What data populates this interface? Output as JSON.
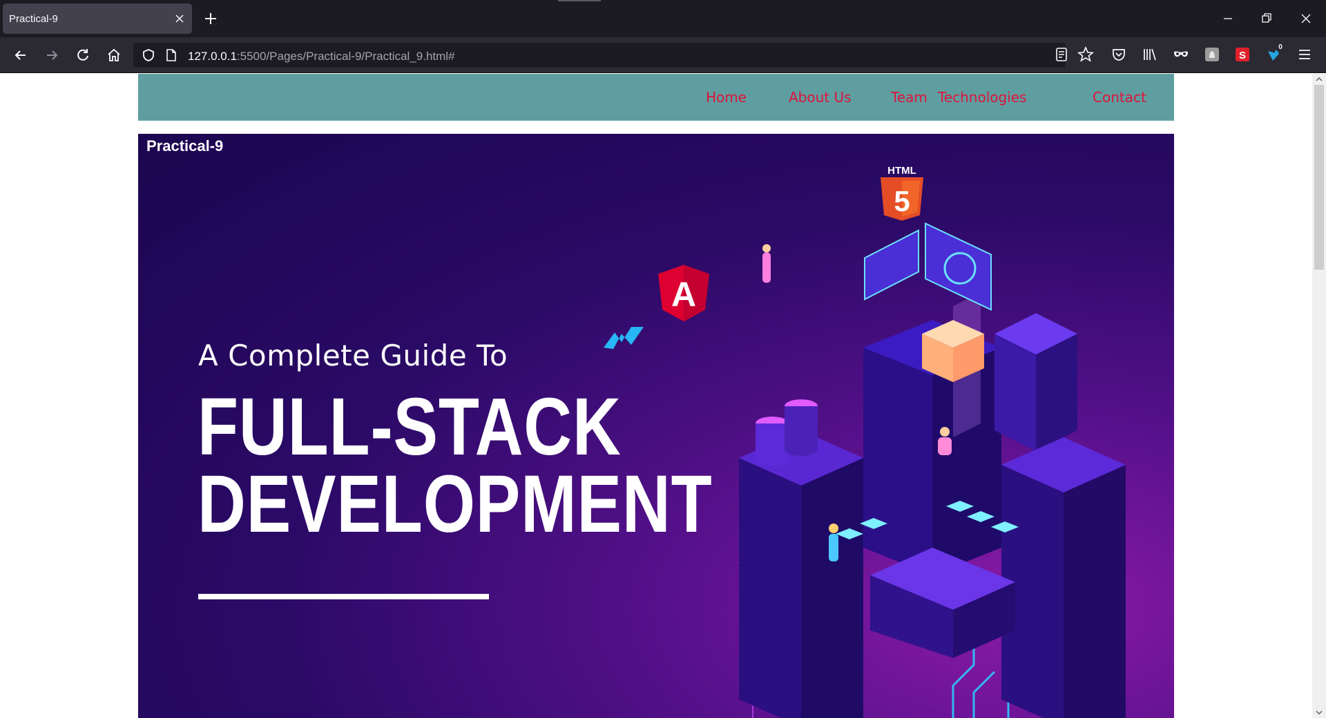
{
  "browser": {
    "tab_title": "Practical-9",
    "url_host": "127.0.0.1",
    "url_path": ":5500/Pages/Practical-9/Practical_9.html#",
    "extension_badge": "0",
    "icons": [
      "back-icon",
      "forward-icon",
      "reload-icon",
      "home-icon",
      "shield-icon",
      "page-icon",
      "reader-view-icon",
      "bookmark-star-icon",
      "pocket-icon",
      "library-icon",
      "mask-icon",
      "extension-icon",
      "s-extension-icon",
      "notification-extension-icon",
      "menu-icon"
    ]
  },
  "site_nav": {
    "links": [
      "Home",
      "About Us",
      "Team",
      "Technologies",
      "Contact"
    ],
    "background": "#5f9ea0",
    "link_color": "#dc143c"
  },
  "hero": {
    "label": "Practical-9",
    "subtitle": "A Complete Guide To",
    "title_line1": "FULL-STACK",
    "title_line2": "DEVELOPMENT",
    "html_badge": "HTML"
  }
}
